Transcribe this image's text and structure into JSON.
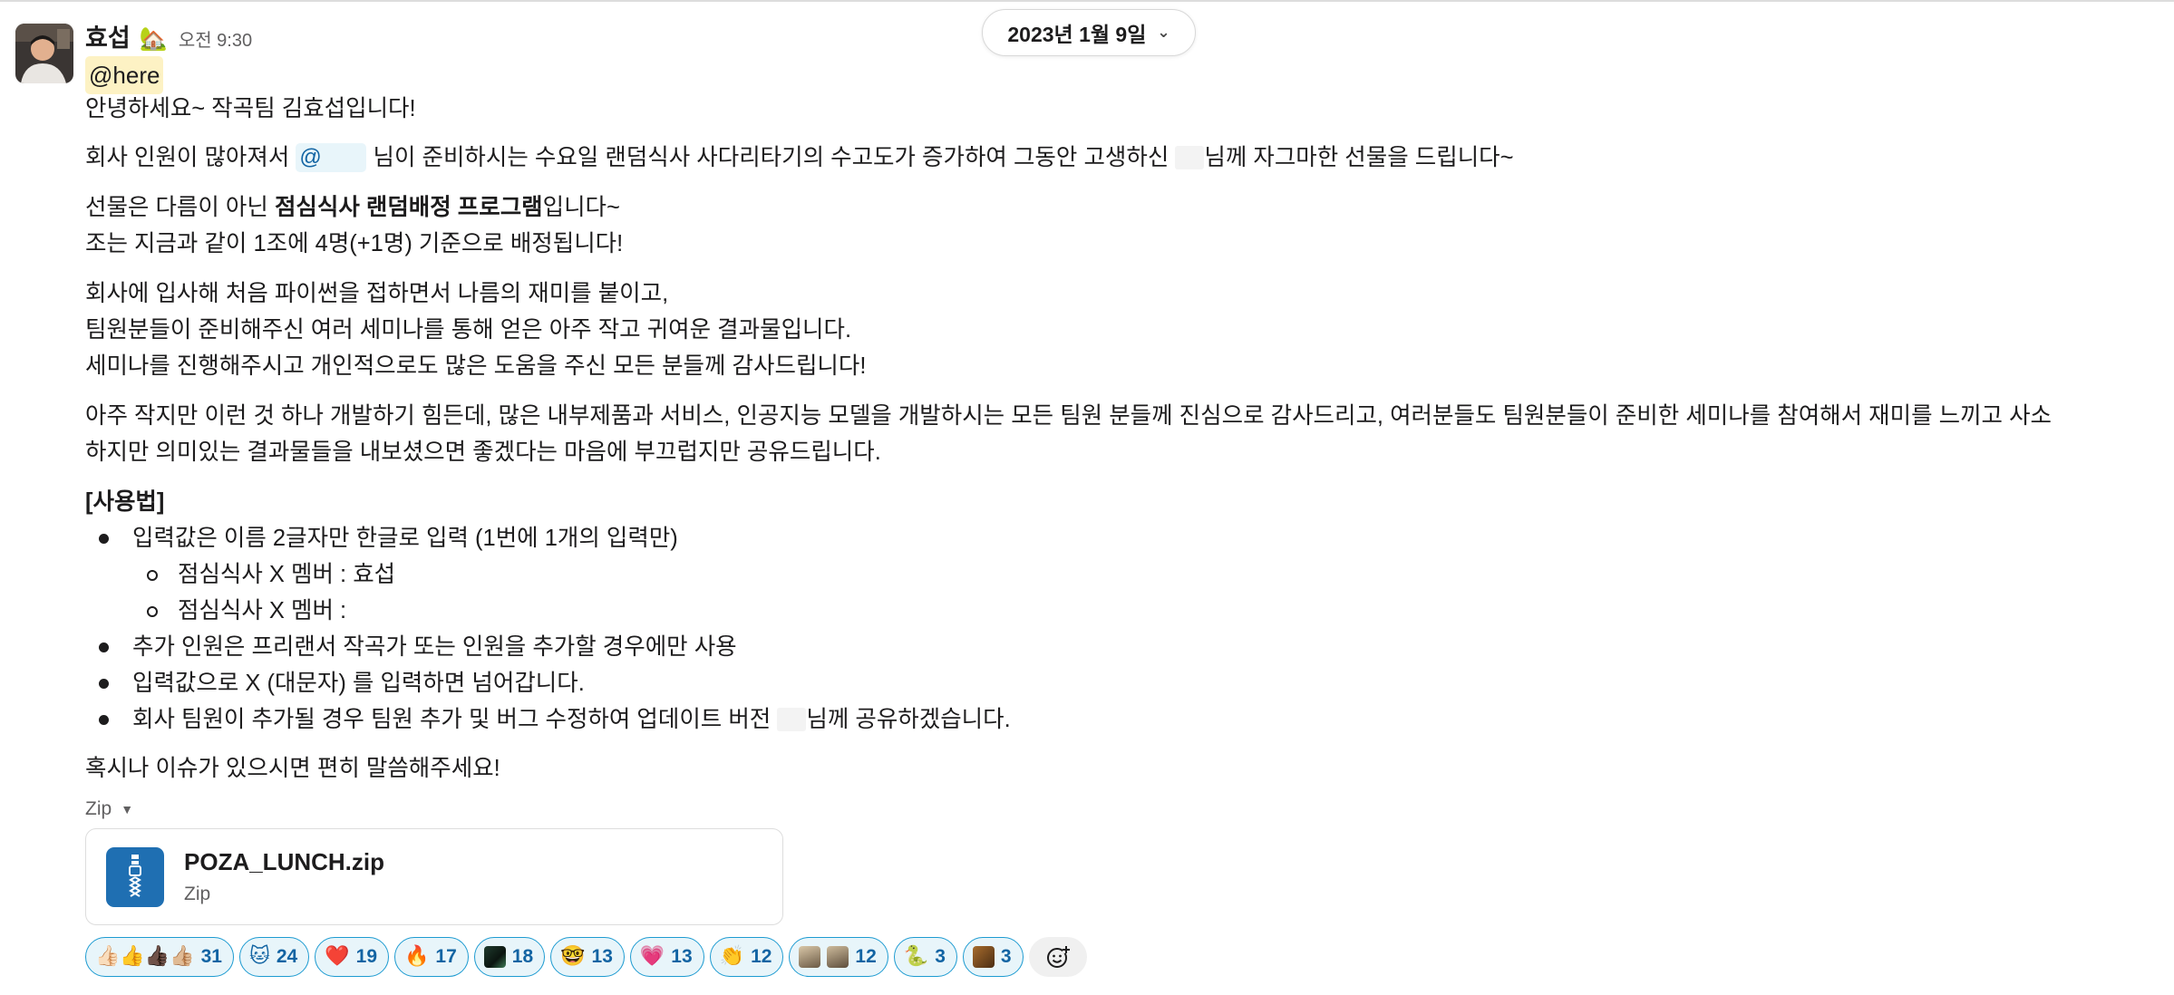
{
  "date_divider": {
    "label": "2023년 1월 9일"
  },
  "message": {
    "sender": "효섭",
    "status_emoji": "🏡",
    "timestamp": "오전 9:30",
    "mention_here": "@here",
    "greeting": "안녕하세요~ 작곡팀 김효섭입니다!",
    "p1_before": "회사 인원이 많아져서",
    "p1_mention": "@",
    "p1_middle": "님이 준비하시는 수요일 랜덤식사 사다리타기의 수고도가 증가하여 그동안 고생하신",
    "p1_after": "님께 자그마한 선물을 드립니다~",
    "p2_before": "선물은 다름이 아닌 ",
    "p2_bold": "점심식사 랜덤배정 프로그램",
    "p2_after": "입니다~",
    "p2_line2": "조는 지금과 같이 1조에 4명(+1명) 기준으로 배정됩니다!",
    "p3_line1": "회사에 입사해 처음 파이썬을 접하면서 나름의 재미를 붙이고,",
    "p3_line2": "팀원분들이 준비해주신 여러 세미나를 통해 얻은 아주 작고 귀여운 결과물입니다.",
    "p3_line3": "세미나를 진행해주시고 개인적으로도 많은 도움을 주신 모든 분들께 감사드립니다!",
    "p4_line1": "아주 작지만 이런 것 하나 개발하기 힘든데, 많은 내부제품과 서비스, 인공지능 모델을 개발하시는 모든 팀원 분들께 진심으로 감사드리고, 여러분들도 팀원분들이 준비한 세미나를 참여해서 재미를 느끼고 사소",
    "p4_line2": "하지만 의미있는 결과물들을 내보셨으면 좋겠다는 마음에 부끄럽지만 공유드립니다.",
    "usage_title": "[사용법]",
    "usage_item1": "입력값은 이름 2글자만 한글로 입력 (1번에 1개의 입력만)",
    "usage_sub1": "점심식사 X 멤버 : 효섭",
    "usage_sub2": "점심식사 X 멤버 :",
    "usage_item2": "추가 인원은 프리랜서 작곡가 또는 인원을 추가할 경우에만 사용",
    "usage_item3": "입력값으로 X (대문자) 를 입력하면 넘어갑니다.",
    "usage_item4_before": "회사 팀원이 추가될 경우 팀원 추가 및 버그 수정하여 업데이트 버전",
    "usage_item4_after": "님께 공유하겠습니다.",
    "closing": "혹시나 이슈가 있으시면 편히 말씀해주세요!"
  },
  "attachment": {
    "group_label": "Zip",
    "file_name": "POZA_LUNCH.zip",
    "file_type": "Zip"
  },
  "reactions": [
    {
      "emoji": "👍🏻👍👍🏿👍🏼",
      "count": "31"
    },
    {
      "emoji": "🐱",
      "count": "24"
    },
    {
      "emoji": "❤️",
      "count": "19"
    },
    {
      "emoji": "🔥",
      "count": "17"
    },
    {
      "emoji": "tile-dark",
      "count": "18"
    },
    {
      "emoji": "🤓",
      "count": "13"
    },
    {
      "emoji": "💗",
      "count": "13"
    },
    {
      "emoji": "👏",
      "count": "12"
    },
    {
      "emoji": "tile-pair",
      "count": "12"
    },
    {
      "emoji": "🐍",
      "count": "3"
    },
    {
      "emoji": "tile-brown",
      "count": "3"
    }
  ]
}
